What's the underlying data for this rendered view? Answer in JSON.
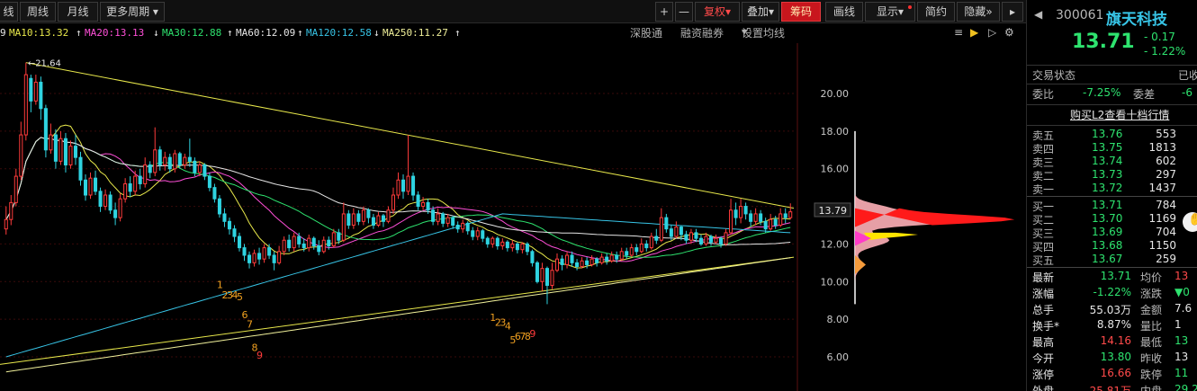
{
  "toolbar": {
    "partial_tab": "线",
    "tabs": [
      "周线",
      "月线"
    ],
    "more_period": "更多周期",
    "plus": "+",
    "minus": "—",
    "fuquan": "复权",
    "overlay": "叠加",
    "chips": "筹码",
    "draw_line": "画线",
    "display": "显示",
    "simple": "简约",
    "hide": "隐藏"
  },
  "ma_legend": [
    {
      "text": "9",
      "color": "#e6e6e6"
    },
    {
      "text": "MA10:13.32",
      "color": "#e8e84b",
      "arrow": "↑"
    },
    {
      "text": "MA20:13.13",
      "color": "#ff4fd8",
      "arrow": "↓"
    },
    {
      "text": "MA30:12.88",
      "color": "#2ee36f",
      "arrow": "↑"
    },
    {
      "text": "MA60:12.09",
      "color": "#e6e6e6",
      "arrow": "↑"
    },
    {
      "text": "MA120:12.58",
      "color": "#37c4e6",
      "arrow": "↓"
    },
    {
      "text": "MA250:11.27",
      "color": "#f0f09a",
      "arrow": "↑"
    }
  ],
  "chart_tools": {
    "shen": "深股通",
    "margin": "融资融券",
    "settings": "设置均线"
  },
  "chart_data": {
    "type": "line",
    "title": "",
    "ylim": [
      5,
      22.5
    ],
    "y_ticks": [
      6,
      8,
      10,
      12,
      14,
      16,
      18,
      20
    ],
    "y_tick_labels": [
      "6.00",
      "8.00",
      "10.00",
      "12.00",
      "14.00",
      "16.00",
      "18.00",
      "20.00"
    ],
    "current_price_label": "13.79",
    "current_price": 13.79,
    "max_marker": "←21.64",
    "max_price": 21.64,
    "countdown_labels": [
      {
        "text": "1",
        "i": 43,
        "y": 9.85
      },
      {
        "text": "2",
        "i": 44,
        "y": 9.3
      },
      {
        "text": "3",
        "i": 45,
        "y": 9.3
      },
      {
        "text": "4",
        "i": 46,
        "y": 9.3
      },
      {
        "text": "5",
        "i": 47,
        "y": 9.2
      },
      {
        "text": "6",
        "i": 48,
        "y": 8.25
      },
      {
        "text": "7",
        "i": 49,
        "y": 7.75
      },
      {
        "text": "8",
        "i": 50,
        "y": 6.5
      },
      {
        "text": "9",
        "i": 51,
        "y": 6.1
      },
      {
        "text": "1",
        "i": 98,
        "y": 8.1
      },
      {
        "text": "2",
        "i": 99,
        "y": 7.85
      },
      {
        "text": "3",
        "i": 100,
        "y": 7.85
      },
      {
        "text": "4",
        "i": 101,
        "y": 7.65
      },
      {
        "text": "5",
        "i": 102,
        "y": 6.9
      },
      {
        "text": "6",
        "i": 103,
        "y": 7.1
      },
      {
        "text": "7",
        "i": 104,
        "y": 7.1
      },
      {
        "text": "8",
        "i": 105,
        "y": 7.1
      },
      {
        "text": "9",
        "i": 106,
        "y": 7.25
      }
    ],
    "series": [
      {
        "name": "MA10",
        "color": "#e8e84b",
        "last": 13.32
      },
      {
        "name": "MA20",
        "color": "#ff4fd8",
        "last": 13.13
      },
      {
        "name": "MA30",
        "color": "#2ee36f",
        "last": 12.88
      },
      {
        "name": "MA60",
        "color": "#e6e6e6",
        "last": 12.09
      },
      {
        "name": "MA120",
        "color": "#37c4e6",
        "last": 12.58
      },
      {
        "name": "MA250",
        "color": "#f0f09a",
        "last": 11.27
      }
    ],
    "candles": [
      [
        12.8,
        13.3,
        12.5,
        14.0
      ],
      [
        13.3,
        14.2,
        13.0,
        14.6
      ],
      [
        14.2,
        15.6,
        14.0,
        16.0
      ],
      [
        15.6,
        17.8,
        15.4,
        18.5
      ],
      [
        17.8,
        21.0,
        17.5,
        21.64
      ],
      [
        20.8,
        19.6,
        19.0,
        21.0
      ],
      [
        19.6,
        20.6,
        19.4,
        21.0
      ],
      [
        20.6,
        19.2,
        18.6,
        20.9
      ],
      [
        19.2,
        17.0,
        16.6,
        19.4
      ],
      [
        17.0,
        17.8,
        16.8,
        18.4
      ],
      [
        17.8,
        16.4,
        16.0,
        18.1
      ],
      [
        16.4,
        17.6,
        16.2,
        18.0
      ],
      [
        17.6,
        16.2,
        15.8,
        17.9
      ],
      [
        16.2,
        17.2,
        16.0,
        17.5
      ],
      [
        17.2,
        16.6,
        16.2,
        17.8
      ],
      [
        16.6,
        15.4,
        15.1,
        16.9
      ],
      [
        15.4,
        14.6,
        14.3,
        15.7
      ],
      [
        14.6,
        15.5,
        14.4,
        15.8
      ],
      [
        15.5,
        14.8,
        14.6,
        15.9
      ],
      [
        14.8,
        14.0,
        13.7,
        15.0
      ],
      [
        14.0,
        14.6,
        13.8,
        14.9
      ],
      [
        14.6,
        13.8,
        13.6,
        14.8
      ],
      [
        13.8,
        13.4,
        13.0,
        14.2
      ],
      [
        13.4,
        14.4,
        13.2,
        14.7
      ],
      [
        14.4,
        15.2,
        14.2,
        15.5
      ],
      [
        15.2,
        14.8,
        14.5,
        15.6
      ],
      [
        14.8,
        15.6,
        14.6,
        15.9
      ],
      [
        15.6,
        15.2,
        14.9,
        16.0
      ],
      [
        15.2,
        16.2,
        15.0,
        16.6
      ],
      [
        16.2,
        15.8,
        15.5,
        16.4
      ],
      [
        15.8,
        17.0,
        15.6,
        18.2
      ],
      [
        17.0,
        16.2,
        15.9,
        17.2
      ],
      [
        16.2,
        16.6,
        15.9,
        16.9
      ],
      [
        16.6,
        16.0,
        15.8,
        16.8
      ],
      [
        16.0,
        16.8,
        15.8,
        17.0
      ],
      [
        16.8,
        16.2,
        16.0,
        16.9
      ],
      [
        16.2,
        16.6,
        16.0,
        16.8
      ],
      [
        16.6,
        16.4,
        16.1,
        17.6
      ],
      [
        16.4,
        15.8,
        15.6,
        16.6
      ],
      [
        15.8,
        16.2,
        15.6,
        16.4
      ],
      [
        16.2,
        15.6,
        15.4,
        16.3
      ],
      [
        15.6,
        15.0,
        14.8,
        15.8
      ],
      [
        15.0,
        14.4,
        14.2,
        15.2
      ],
      [
        14.4,
        13.6,
        13.4,
        14.6
      ],
      [
        13.6,
        13.2,
        12.9,
        13.9
      ],
      [
        13.2,
        12.8,
        12.5,
        13.4
      ],
      [
        12.8,
        12.4,
        12.1,
        13.0
      ],
      [
        12.4,
        11.8,
        11.6,
        12.6
      ],
      [
        11.8,
        11.4,
        11.1,
        12.0
      ],
      [
        11.4,
        11.0,
        10.7,
        11.6
      ],
      [
        11.0,
        11.5,
        10.8,
        11.7
      ],
      [
        11.5,
        11.2,
        10.9,
        11.8
      ],
      [
        11.2,
        11.8,
        11.0,
        12.0
      ],
      [
        11.8,
        11.4,
        11.2,
        12.0
      ],
      [
        11.4,
        11.0,
        10.6,
        11.6
      ],
      [
        11.0,
        11.6,
        10.9,
        11.9
      ],
      [
        11.6,
        12.2,
        11.4,
        12.4
      ],
      [
        12.2,
        11.8,
        11.6,
        12.5
      ],
      [
        11.8,
        12.4,
        11.6,
        12.6
      ],
      [
        12.4,
        12.0,
        11.8,
        12.6
      ],
      [
        12.0,
        11.8,
        11.6,
        12.3
      ],
      [
        11.8,
        12.3,
        11.6,
        12.5
      ],
      [
        12.3,
        11.9,
        11.7,
        12.4
      ],
      [
        11.9,
        11.6,
        11.4,
        12.2
      ],
      [
        11.6,
        12.2,
        11.5,
        12.4
      ],
      [
        12.2,
        11.9,
        11.7,
        12.4
      ],
      [
        11.9,
        12.6,
        11.8,
        12.8
      ],
      [
        12.6,
        12.2,
        12.0,
        12.8
      ],
      [
        12.2,
        13.6,
        12.1,
        14.2
      ],
      [
        13.6,
        13.0,
        12.8,
        13.8
      ],
      [
        13.0,
        13.6,
        12.8,
        13.9
      ],
      [
        13.6,
        13.2,
        13.0,
        13.8
      ],
      [
        13.2,
        13.8,
        13.0,
        14.0
      ],
      [
        13.8,
        13.4,
        13.1,
        13.9
      ],
      [
        13.4,
        13.0,
        12.8,
        13.6
      ],
      [
        13.0,
        13.5,
        12.9,
        13.7
      ],
      [
        13.5,
        13.2,
        12.9,
        13.6
      ],
      [
        13.2,
        13.8,
        13.1,
        14.0
      ],
      [
        13.8,
        14.6,
        13.6,
        15.0
      ],
      [
        14.6,
        15.4,
        14.4,
        15.8
      ],
      [
        15.4,
        14.8,
        14.4,
        15.7
      ],
      [
        14.8,
        15.6,
        14.6,
        17.8
      ],
      [
        15.6,
        14.6,
        14.3,
        15.8
      ],
      [
        14.6,
        14.0,
        13.8,
        14.8
      ],
      [
        14.0,
        14.2,
        13.8,
        14.5
      ],
      [
        14.2,
        13.8,
        13.6,
        14.4
      ],
      [
        13.8,
        13.2,
        13.0,
        14.0
      ],
      [
        13.2,
        13.6,
        13.0,
        13.9
      ],
      [
        13.6,
        13.1,
        12.9,
        13.7
      ],
      [
        13.1,
        13.4,
        12.9,
        13.6
      ],
      [
        13.4,
        13.0,
        12.8,
        13.5
      ],
      [
        13.0,
        12.8,
        12.6,
        13.2
      ],
      [
        12.8,
        13.1,
        12.6,
        13.3
      ],
      [
        13.1,
        12.7,
        12.5,
        13.2
      ],
      [
        12.7,
        12.4,
        12.2,
        12.9
      ],
      [
        12.4,
        12.7,
        12.2,
        12.9
      ],
      [
        12.7,
        12.3,
        12.1,
        12.8
      ],
      [
        12.3,
        12.0,
        11.8,
        12.4
      ],
      [
        12.0,
        12.3,
        11.8,
        12.4
      ],
      [
        12.3,
        11.9,
        11.7,
        12.4
      ],
      [
        11.9,
        12.1,
        11.7,
        12.3
      ],
      [
        12.1,
        11.8,
        11.6,
        12.2
      ],
      [
        11.8,
        12.0,
        11.6,
        12.2
      ],
      [
        12.0,
        11.7,
        11.5,
        12.1
      ],
      [
        11.7,
        12.0,
        11.5,
        12.1
      ],
      [
        12.0,
        11.6,
        11.4,
        12.1
      ],
      [
        11.6,
        11.0,
        10.8,
        11.7
      ],
      [
        11.0,
        10.0,
        9.9,
        11.1
      ],
      [
        10.0,
        10.7,
        9.5,
        11.0
      ],
      [
        10.7,
        9.8,
        8.8,
        10.8
      ],
      [
        9.8,
        10.6,
        9.6,
        11.0
      ],
      [
        10.6,
        11.2,
        10.5,
        11.5
      ],
      [
        11.2,
        10.9,
        10.6,
        11.4
      ],
      [
        10.9,
        11.4,
        10.7,
        11.6
      ],
      [
        11.4,
        11.0,
        10.8,
        11.6
      ],
      [
        11.0,
        10.8,
        10.6,
        11.2
      ],
      [
        10.8,
        11.1,
        10.7,
        11.3
      ],
      [
        11.1,
        10.9,
        10.7,
        11.3
      ],
      [
        10.9,
        11.2,
        10.8,
        11.4
      ],
      [
        11.2,
        11.0,
        10.8,
        11.3
      ],
      [
        11.0,
        11.3,
        10.9,
        11.5
      ],
      [
        11.3,
        11.1,
        10.9,
        11.5
      ],
      [
        11.1,
        11.4,
        11.0,
        11.6
      ],
      [
        11.4,
        11.2,
        11.0,
        11.6
      ],
      [
        11.2,
        11.6,
        11.1,
        11.8
      ],
      [
        11.6,
        11.4,
        11.2,
        11.8
      ],
      [
        11.4,
        11.8,
        11.3,
        12.0
      ],
      [
        11.8,
        11.6,
        11.4,
        12.0
      ],
      [
        11.6,
        12.0,
        11.5,
        12.3
      ],
      [
        12.0,
        11.8,
        11.6,
        12.2
      ],
      [
        11.8,
        12.4,
        11.7,
        12.6
      ],
      [
        12.4,
        12.2,
        12.0,
        12.8
      ],
      [
        12.2,
        13.4,
        12.1,
        13.9
      ],
      [
        13.4,
        12.8,
        12.6,
        13.6
      ],
      [
        12.8,
        12.4,
        12.2,
        13.0
      ],
      [
        12.4,
        12.9,
        12.3,
        13.2
      ],
      [
        12.9,
        12.5,
        12.2,
        13.0
      ],
      [
        12.5,
        12.2,
        12.0,
        12.7
      ],
      [
        12.2,
        12.6,
        12.0,
        12.8
      ],
      [
        12.6,
        12.3,
        12.1,
        12.8
      ],
      [
        12.3,
        12.0,
        11.9,
        12.5
      ],
      [
        12.0,
        12.4,
        11.9,
        12.6
      ],
      [
        12.4,
        12.1,
        11.9,
        12.5
      ],
      [
        12.1,
        12.3,
        12.0,
        12.5
      ],
      [
        12.3,
        12.0,
        11.8,
        12.4
      ],
      [
        12.0,
        12.6,
        11.9,
        12.8
      ],
      [
        12.6,
        13.8,
        12.5,
        14.4
      ],
      [
        13.8,
        13.4,
        13.0,
        14.2
      ],
      [
        13.4,
        14.0,
        13.1,
        14.4
      ],
      [
        14.0,
        13.6,
        13.3,
        14.2
      ],
      [
        13.6,
        13.2,
        12.9,
        13.8
      ],
      [
        13.2,
        13.6,
        13.0,
        13.9
      ],
      [
        13.6,
        13.2,
        13.0,
        13.8
      ],
      [
        13.2,
        12.8,
        12.6,
        13.4
      ],
      [
        12.8,
        13.3,
        12.7,
        13.6
      ],
      [
        13.3,
        13.0,
        12.8,
        13.5
      ],
      [
        13.0,
        13.6,
        12.9,
        13.9
      ],
      [
        13.6,
        13.4,
        13.1,
        13.9
      ],
      [
        13.4,
        13.71,
        13.3,
        14.16
      ]
    ]
  },
  "chip_dist": {
    "cost_label": "13.79"
  },
  "panel": {
    "code": "300061",
    "name": "旗天科技",
    "price": "13.71",
    "change": "- 0.17",
    "change_pct": "- 1.22%",
    "trade_status_label": "交易状态",
    "trade_status_value": "已收",
    "wei_bi_label": "委比",
    "wei_bi_value": "-7.25%",
    "wei_cha_label": "委差",
    "wei_cha_value": "-6",
    "l2_link": "购买L2查看十档行情",
    "sell": [
      {
        "label": "卖五",
        "price": "13.76",
        "vol": "553"
      },
      {
        "label": "卖四",
        "price": "13.75",
        "vol": "1813"
      },
      {
        "label": "卖三",
        "price": "13.74",
        "vol": "602"
      },
      {
        "label": "卖二",
        "price": "13.73",
        "vol": "297"
      },
      {
        "label": "卖一",
        "price": "13.72",
        "vol": "1437"
      }
    ],
    "buy": [
      {
        "label": "买一",
        "price": "13.71",
        "vol": "784"
      },
      {
        "label": "买二",
        "price": "13.70",
        "vol": "1169"
      },
      {
        "label": "买三",
        "price": "13.69",
        "vol": "704"
      },
      {
        "label": "买四",
        "price": "13.68",
        "vol": "1150"
      },
      {
        "label": "买五",
        "price": "13.67",
        "vol": "259"
      }
    ],
    "stats": [
      {
        "l1": "最新",
        "v1": "13.71",
        "c1": "green",
        "l2": "均价",
        "v2": "13",
        "c2": "red"
      },
      {
        "l1": "涨幅",
        "v1": "-1.22%",
        "c1": "green",
        "l2": "涨跌",
        "v2": "▼0",
        "c2": "green"
      },
      {
        "l1": "总手",
        "v1": "55.03万",
        "c1": "white",
        "l2": "金额",
        "v2": "7.6",
        "c2": "white"
      },
      {
        "l1": "换手*",
        "v1": "8.87%",
        "c1": "white",
        "l2": "量比",
        "v2": "1",
        "c2": "white"
      },
      {
        "l1": "最高",
        "v1": "14.16",
        "c1": "red",
        "l2": "最低",
        "v2": "13",
        "c2": "green"
      },
      {
        "l1": "今开",
        "v1": "13.80",
        "c1": "green",
        "l2": "昨收",
        "v2": "13",
        "c2": "white"
      },
      {
        "l1": "涨停",
        "v1": "16.66",
        "c1": "red",
        "l2": "跌停",
        "v2": "11",
        "c2": "green"
      },
      {
        "l1": "外盘",
        "v1": "25.81万",
        "c1": "red",
        "l2": "内盘",
        "v2": "29.2",
        "c2": "green"
      }
    ]
  }
}
